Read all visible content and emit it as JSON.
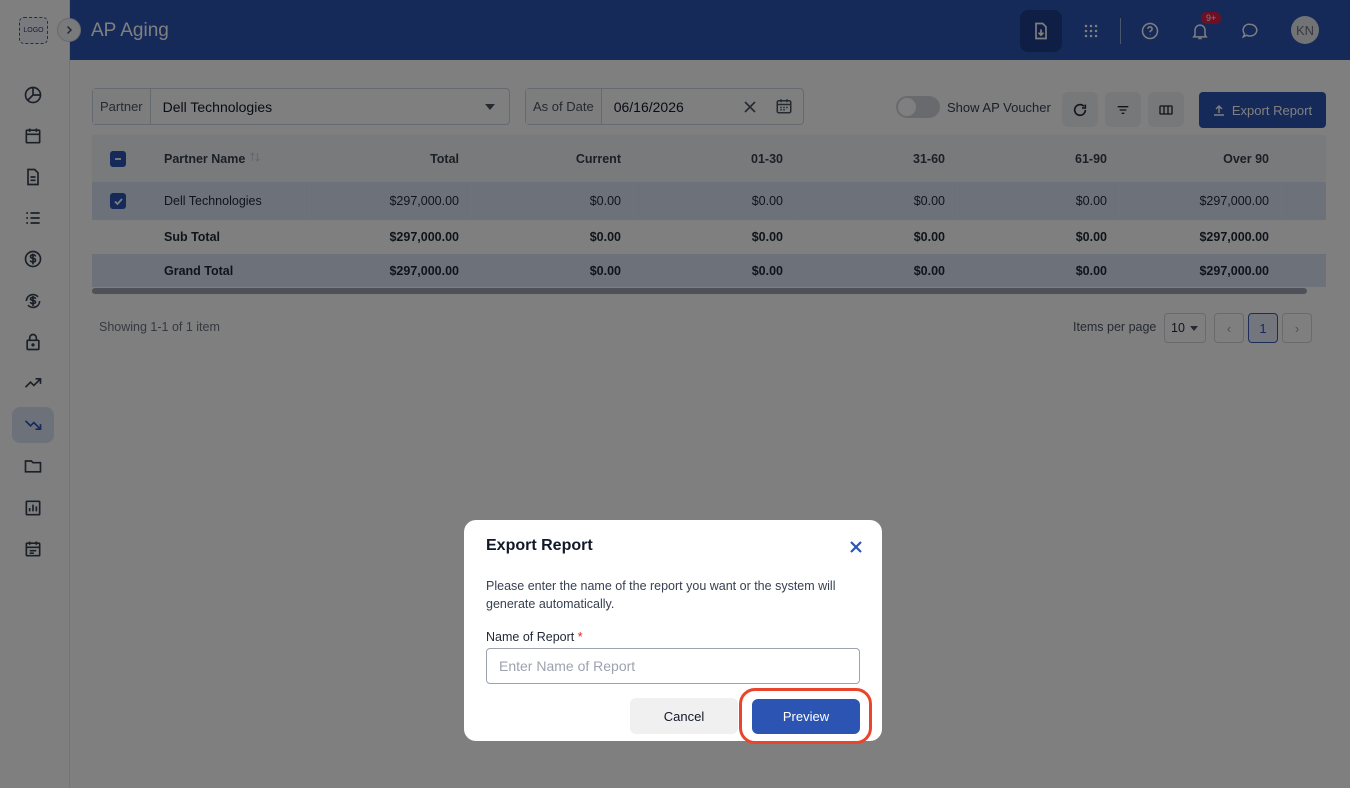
{
  "app": {
    "logo_text": "LOGO",
    "title": "AP Aging"
  },
  "header": {
    "notification_badge": "9+",
    "avatar_initials": "KN",
    "icons": [
      "export-download-icon",
      "apps-grid-icon",
      "help-icon",
      "bell-icon",
      "chat-icon"
    ]
  },
  "sidebar": {
    "icons": [
      "dashboard-icon",
      "calendar-icon",
      "document-icon",
      "list-icon",
      "dollar-icon",
      "currency-exchange-icon",
      "lock-icon",
      "trending-up-icon",
      "trending-down-icon",
      "folder-icon",
      "report-chart-icon",
      "schedule-icon"
    ],
    "active": "trending-down-icon"
  },
  "filters": {
    "partner_label": "Partner",
    "partner_value": "Dell Technologies",
    "date_label": "As of Date",
    "date_value": "06/16/2026",
    "toggle_label": "Show AP Voucher",
    "export_label": "Export Report"
  },
  "table": {
    "headers": [
      "Partner Name",
      "Total",
      "Current",
      "01-30",
      "31-60",
      "61-90",
      "Over 90"
    ],
    "row": {
      "name": "Dell Technologies",
      "total": "$297,000.00",
      "current": "$0.00",
      "d1_30": "$0.00",
      "d31_60": "$0.00",
      "d61_90": "$0.00",
      "over90": "$297,000.00"
    },
    "subtotal": {
      "name": "Sub Total",
      "total": "$297,000.00",
      "current": "$0.00",
      "d1_30": "$0.00",
      "d31_60": "$0.00",
      "d61_90": "$0.00",
      "over90": "$297,000.00"
    },
    "grandtotal": {
      "name": "Grand Total",
      "total": "$297,000.00",
      "current": "$0.00",
      "d1_30": "$0.00",
      "d31_60": "$0.00",
      "d61_90": "$0.00",
      "over90": "$297,000.00"
    }
  },
  "pagination": {
    "showing": "Showing 1-1 of 1 item",
    "items_per_page_label": "Items per page",
    "items_per_page": "10",
    "current_page": "1",
    "prev": "‹",
    "next": "›"
  },
  "modal": {
    "title": "Export Report",
    "description": "Please enter the name of the report you want or the system will generate automatically.",
    "field_label": "Name of Report",
    "required_mark": "*",
    "placeholder": "Enter Name of Report",
    "cancel_label": "Cancel",
    "preview_label": "Preview"
  },
  "colors": {
    "brand": "#2c54b3",
    "highlight": "#e8452c"
  }
}
